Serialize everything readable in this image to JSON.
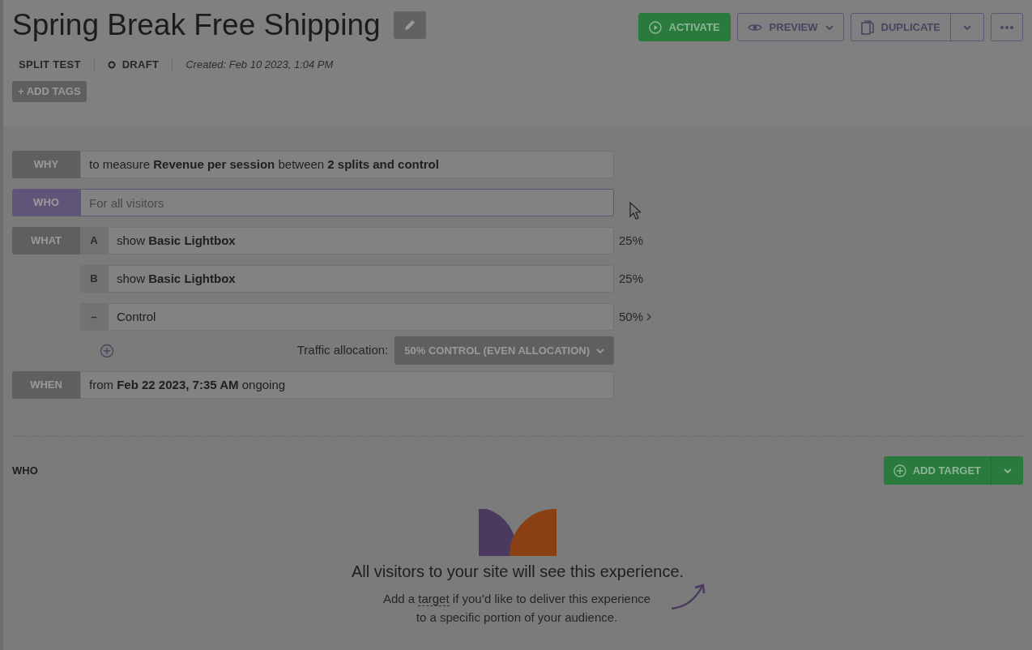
{
  "header": {
    "title": "Spring Break Free Shipping",
    "type": "SPLIT TEST",
    "status": "DRAFT",
    "created": "Created: Feb 10 2023, 1:04 PM",
    "add_tags": "+ ADD TAGS",
    "actions": [
      {
        "kind": "primary",
        "label": "ACTIVATE"
      },
      {
        "kind": "outline",
        "label": "PREVIEW"
      },
      {
        "kind": "split",
        "label": "DUPLICATE"
      },
      {
        "kind": "more"
      }
    ]
  },
  "summary": [
    {
      "kind": "text",
      "label": "WHY",
      "focused": false,
      "text": "to measure **Revenue per session** between **2 splits and control**"
    },
    {
      "kind": "text",
      "label": "WHO",
      "focused": true,
      "placeholder": "For all visitors"
    },
    {
      "kind": "variants",
      "label": "WHAT",
      "focused": false,
      "variants": [
        {
          "key": "A",
          "text": "show **Basic Lightbox**",
          "share": "25%",
          "expandable": false
        },
        {
          "key": "B",
          "text": "show **Basic Lightbox**",
          "share": "25%",
          "expandable": false
        },
        {
          "key": "–",
          "text": "Control",
          "share": "50%",
          "expandable": true
        }
      ],
      "traffic_label": "Traffic allocation:",
      "traffic_value": "50% CONTROL (EVEN ALLOCATION)"
    },
    {
      "kind": "text",
      "label": "WHEN",
      "focused": false,
      "text": "from **Feb 22 2023, 7:35 AM** ongoing"
    }
  ],
  "who_section": {
    "heading": "WHO",
    "button": "ADD TARGET",
    "empty_title": "All visitors to your site will see this experience.",
    "empty_before": "Add a ",
    "empty_link": "target",
    "empty_after": " if you’d like to deliver this experience to a specific portion of your audience."
  }
}
